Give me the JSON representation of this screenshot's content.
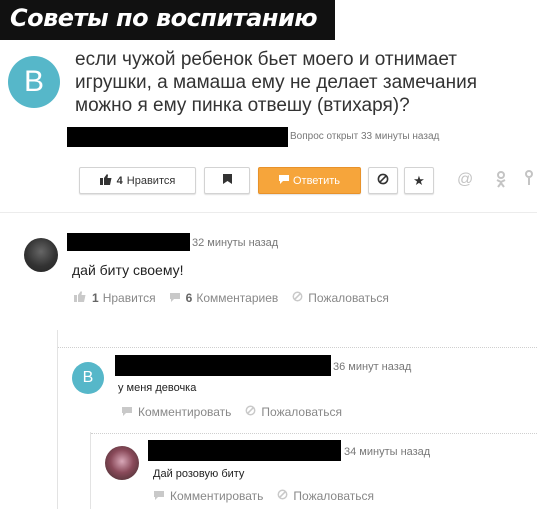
{
  "banner": {
    "title": "Советы по воспитанию"
  },
  "question": {
    "avatar_letter": "B",
    "text": "если чужой ребенок бьет моего и отнимает игрушки, а мамаша ему не делает замечания можно я ему пинка отвешу (втихаря)?",
    "meta": "Вопрос открыт 33 минуты назад",
    "buttons": {
      "like_count": "4",
      "like_label": "Нравится",
      "answer_label": "Ответить"
    }
  },
  "comment1": {
    "time": "32 минуты назад",
    "text": "дай биту своему!",
    "like_count": "1",
    "like_label": "Нравится",
    "comments_count": "6",
    "comments_label": "Комментариев",
    "report_label": "Пожаловаться"
  },
  "reply1": {
    "avatar_letter": "B",
    "time": "36 минут назад",
    "text": "у меня девочка",
    "comment_label": "Комментировать",
    "report_label": "Пожаловаться"
  },
  "reply2": {
    "time": "34 минуты назад",
    "text": "Дай розовую биту",
    "comment_label": "Комментировать",
    "report_label": "Пожаловаться"
  },
  "colors": {
    "accent_orange": "#f6a53b",
    "avatar_teal": "#56b7c9",
    "banner_black": "#111111"
  }
}
